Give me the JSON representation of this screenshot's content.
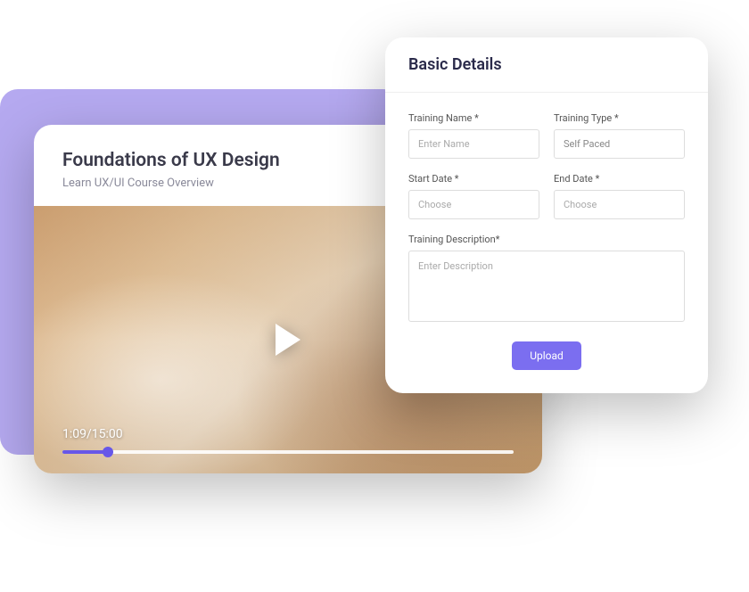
{
  "video": {
    "title": "Foundations of UX Design",
    "subtitle": "Learn UX/UI Course Overview",
    "time": "1:09/15:00"
  },
  "form": {
    "title": "Basic Details",
    "fields": {
      "training_name": {
        "label": "Training Name *",
        "placeholder": "Enter Name"
      },
      "training_type": {
        "label": "Training Type *",
        "value": "Self Paced"
      },
      "start_date": {
        "label": "Start Date *",
        "placeholder": "Choose"
      },
      "end_date": {
        "label": "End Date *",
        "placeholder": "Choose"
      },
      "description": {
        "label": "Training Description*",
        "placeholder": "Enter Description"
      }
    },
    "upload_label": "Upload"
  }
}
